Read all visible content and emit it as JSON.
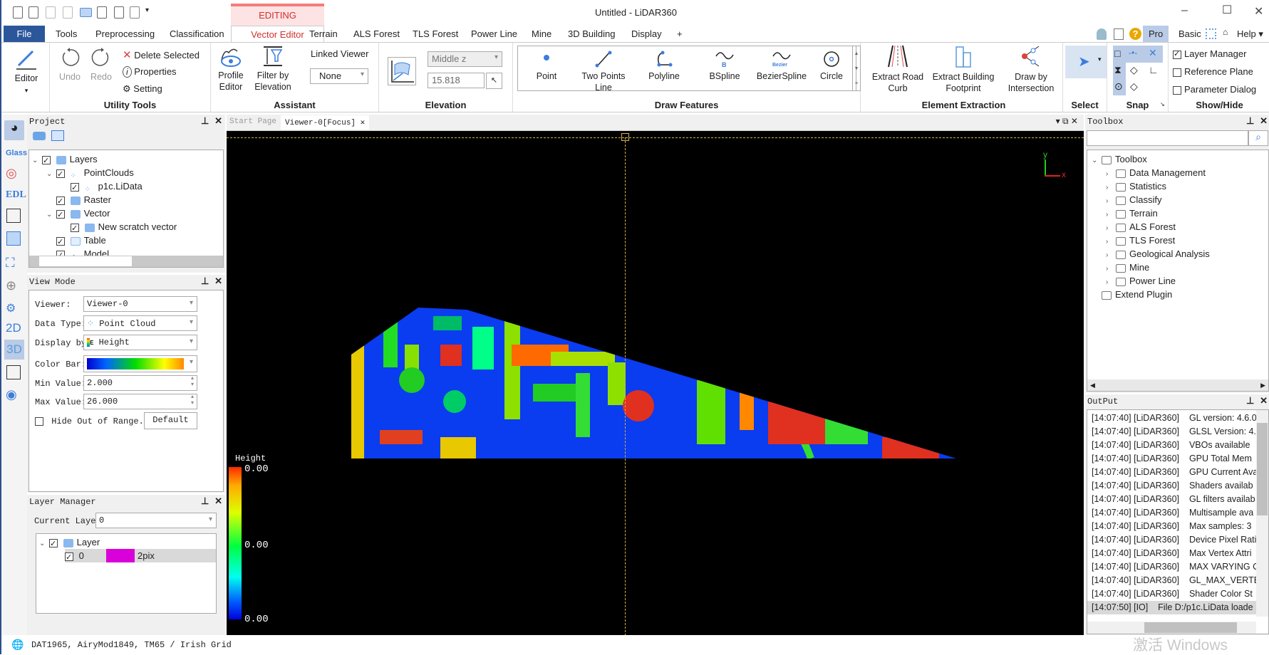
{
  "window": {
    "title": "Untitled - LiDAR360",
    "editing_badge": "EDITING"
  },
  "menu_tabs": [
    {
      "label": "File"
    },
    {
      "label": "Tools"
    },
    {
      "label": "Preprocessing"
    },
    {
      "label": "Classification"
    },
    {
      "label": "Vector Editor"
    },
    {
      "label": "Terrain"
    },
    {
      "label": "ALS Forest"
    },
    {
      "label": "TLS Forest"
    },
    {
      "label": "Power Line"
    },
    {
      "label": "Mine"
    },
    {
      "label": "3D Building"
    },
    {
      "label": "Display"
    },
    {
      "label": "+"
    }
  ],
  "top_right": {
    "pro": "Pro",
    "basic": "Basic",
    "help": "Help"
  },
  "ribbon": {
    "editor": "Editor",
    "utility": {
      "undo": "Undo",
      "redo": "Redo",
      "delete": "Delete Selected",
      "properties": "Properties",
      "setting": "Setting",
      "group": "Utility Tools"
    },
    "assistant": {
      "profile_editor": "Profile Editor",
      "filter_by_elevation": "Filter by Elevation",
      "linked_viewer_label": "Linked Viewer",
      "linked_viewer_value": "None",
      "group": "Assistant"
    },
    "elevation": {
      "mode": "Middle z",
      "value": "15.818",
      "group": "Elevation"
    },
    "draw": {
      "items": [
        "Point",
        "Two Points Line",
        "Polyline",
        "BSpline",
        "BezierSpline",
        "Circle"
      ],
      "bspline_glyph": "B",
      "bezier_glyph": "Bezier",
      "group": "Draw Features"
    },
    "extraction": {
      "road": "Extract Road Curb",
      "building": "Extract Building Footprint",
      "intersection": "Draw by Intersection",
      "group": "Element Extraction"
    },
    "select": {
      "group": "Select"
    },
    "snap": {
      "group": "Snap"
    },
    "show_hide": {
      "items": [
        {
          "label": "Layer Manager",
          "checked": true
        },
        {
          "label": "Reference Plane",
          "checked": false
        },
        {
          "label": "Parameter Dialog",
          "checked": false
        }
      ],
      "group": "Show/Hide"
    }
  },
  "left_strip": {
    "glass": "Glass",
    "edl": "EDL",
    "2d": "2D",
    "3d": "3D"
  },
  "project": {
    "title": "Project",
    "tree": [
      {
        "label": "Layers",
        "level": 0,
        "expanded": true
      },
      {
        "label": "PointClouds",
        "level": 1,
        "expanded": true
      },
      {
        "label": "p1c.LiData",
        "level": 2
      },
      {
        "label": "Raster",
        "level": 1
      },
      {
        "label": "Vector",
        "level": 1,
        "expanded": true
      },
      {
        "label": "New scratch vector",
        "level": 2
      },
      {
        "label": "Table",
        "level": 1
      },
      {
        "label": "Model",
        "level": 1
      }
    ]
  },
  "view_mode": {
    "title": "View Mode",
    "viewer_label": "Viewer:",
    "viewer_value": "Viewer-0",
    "data_type_label": "Data Type:",
    "data_type_value": "Point Cloud",
    "display_by_label": "Display by:",
    "display_by_value": "Height",
    "color_bar_label": "Color Bar:",
    "min_label": "Min Value:",
    "min_value": "2.000",
    "max_label": "Max Value:",
    "max_value": "26.000",
    "hide_out_of_range": "Hide Out of Range.",
    "hide_checked": false,
    "default_button": "Default"
  },
  "layer_manager": {
    "title": "Layer Manager",
    "current_layer_label": "Current Layer",
    "current_layer_value": "0",
    "root": "Layer",
    "rows": [
      {
        "name": "0",
        "color": "#d900d9",
        "width": "2pix"
      }
    ]
  },
  "viewer": {
    "tabs": [
      {
        "label": "Start Page"
      },
      {
        "label": "Viewer-0[Focus]"
      }
    ],
    "legend_title": "Height",
    "legend_labels": [
      "0.00",
      "0.00",
      "0.00"
    ],
    "axis_x": "x",
    "axis_y": "y"
  },
  "toolbox": {
    "title": "Toolbox",
    "search_placeholder": "",
    "root": "Toolbox",
    "items": [
      "Data Management",
      "Statistics",
      "Classify",
      "Terrain",
      "ALS Forest",
      "TLS Forest",
      "Geological Analysis",
      "Mine",
      "Power Line"
    ],
    "extend": "Extend Plugin"
  },
  "output": {
    "title": "OutPut",
    "rows": [
      {
        "time": "[14:07:40]",
        "src": "[LiDAR360]",
        "msg": "GL version: 4.6.0"
      },
      {
        "time": "[14:07:40]",
        "src": "[LiDAR360]",
        "msg": "GLSL Version: 4."
      },
      {
        "time": "[14:07:40]",
        "src": "[LiDAR360]",
        "msg": "VBOs available"
      },
      {
        "time": "[14:07:40]",
        "src": "[LiDAR360]",
        "msg": "GPU Total Mem"
      },
      {
        "time": "[14:07:40]",
        "src": "[LiDAR360]",
        "msg": "GPU Current Ava"
      },
      {
        "time": "[14:07:40]",
        "src": "[LiDAR360]",
        "msg": "Shaders availab"
      },
      {
        "time": "[14:07:40]",
        "src": "[LiDAR360]",
        "msg": "GL filters availab"
      },
      {
        "time": "[14:07:40]",
        "src": "[LiDAR360]",
        "msg": "Multisample ava"
      },
      {
        "time": "[14:07:40]",
        "src": "[LiDAR360]",
        "msg": "Max samples: 3"
      },
      {
        "time": "[14:07:40]",
        "src": "[LiDAR360]",
        "msg": "Device Pixel Rati"
      },
      {
        "time": "[14:07:40]",
        "src": "[LiDAR360]",
        "msg": "Max Vertex Attri"
      },
      {
        "time": "[14:07:40]",
        "src": "[LiDAR360]",
        "msg": "MAX VARYING C"
      },
      {
        "time": "[14:07:40]",
        "src": "[LiDAR360]",
        "msg": "GL_MAX_VERTEX"
      },
      {
        "time": "[14:07:40]",
        "src": "[LiDAR360]",
        "msg": "Shader Color St"
      },
      {
        "time": "[14:07:50]",
        "src": "[IO]",
        "msg": "File D:/p1c.LiData loade"
      }
    ]
  },
  "status_bar": {
    "crs": "DAT1965, AiryMod1849, TM65 / Irish Grid",
    "watermark": "激活 Windows"
  },
  "colors": {
    "accent": "#2b579a",
    "editing": "#d0312d",
    "layer_color": "#d900d9"
  }
}
